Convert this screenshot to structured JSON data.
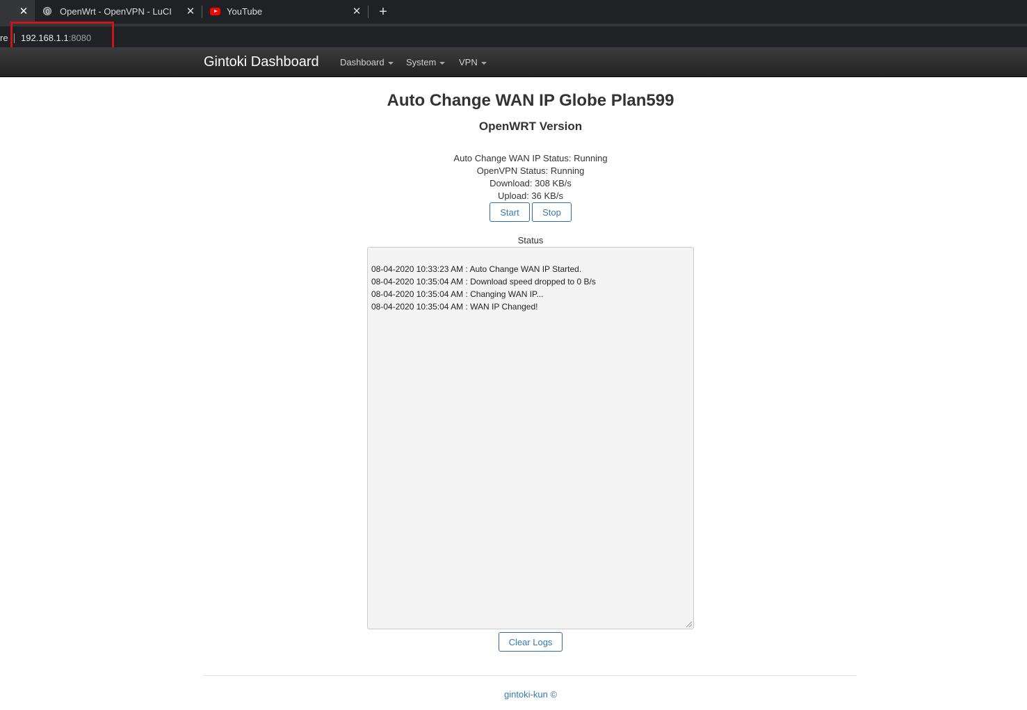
{
  "browser": {
    "tabs": [
      {
        "title": "OpenWrt - OpenVPN - LuCI",
        "icon": "globe-icon"
      },
      {
        "title": "YouTube",
        "icon": "youtube-icon"
      }
    ],
    "address": {
      "prefix_fragment": "re",
      "host": "192.168.1.1",
      "port": ":8080"
    }
  },
  "navbar": {
    "brand": "Gintoki Dashboard",
    "items": [
      {
        "label": "Dashboard"
      },
      {
        "label": "System"
      },
      {
        "label": "VPN"
      }
    ]
  },
  "main": {
    "title": "Auto Change WAN IP Globe Plan599",
    "subtitle": "OpenWRT Version",
    "status_lines": [
      "Auto Change WAN IP Status: Running",
      "OpenVPN Status: Running",
      "Download: 308 KB/s",
      "Upload: 36 KB/s"
    ],
    "buttons": {
      "start": "Start",
      "stop": "Stop",
      "clear": "Clear Logs"
    },
    "status_label": "Status",
    "log_lines": [
      "08-04-2020 10:33:23 AM : Auto Change WAN IP Started.",
      "08-04-2020 10:35:04 AM : Download speed dropped to 0 B/s",
      "08-04-2020 10:35:04 AM : Changing WAN IP...",
      "08-04-2020 10:35:04 AM : WAN IP Changed!"
    ]
  },
  "footer": {
    "text": "gintoki-kun ©"
  },
  "colors": {
    "chrome_dark": "#202124",
    "navbar": "#222222",
    "link_blue": "#337ab7",
    "highlight_red": "#d0141c"
  }
}
